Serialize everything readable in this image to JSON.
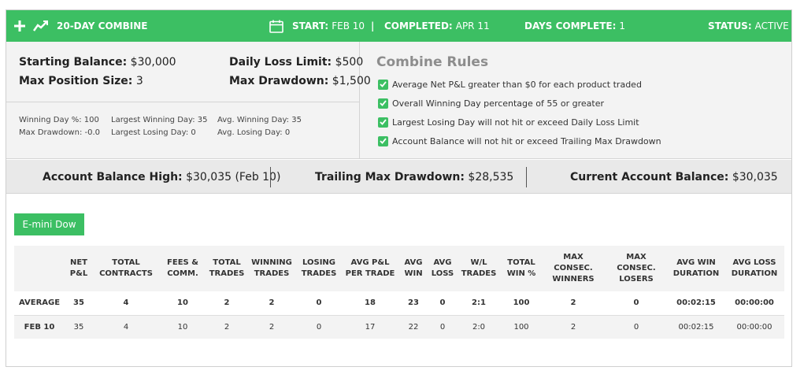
{
  "header": {
    "title": "20-DAY COMBINE",
    "start_label": "START:",
    "start_value": "FEB 10",
    "separator": "|",
    "completed_label": "COMPLETED:",
    "completed_value": "APR 11",
    "days_label": "DAYS COMPLETE:",
    "days_value": "1",
    "status_label": "STATUS:",
    "status_value": "ACTIVE",
    "accent_color": "#3cbf63",
    "icons": [
      "plus-icon",
      "trend-line-icon",
      "calendar-icon"
    ]
  },
  "account": {
    "starting_balance_label": "Starting Balance:",
    "starting_balance": "$30,000",
    "max_position_label": "Max Position Size:",
    "max_position": "3",
    "daily_loss_label": "Daily Loss Limit:",
    "daily_loss": "$500",
    "max_drawdown_label": "Max Drawdown:",
    "max_drawdown": "$1,500"
  },
  "metrics": {
    "winning_day_pct_label": "Winning Day %:",
    "winning_day_pct": "100",
    "max_drawdown_label": "Max Drawdown:",
    "max_drawdown": "-0.0",
    "largest_win_label": "Largest Winning Day:",
    "largest_win": "35",
    "largest_loss_label": "Largest Losing Day:",
    "largest_loss": "0",
    "avg_win_label": "Avg. Winning Day:",
    "avg_win": "35",
    "avg_loss_label": "Avg. Losing Day:",
    "avg_loss": "0"
  },
  "rules": {
    "title": "Combine Rules",
    "items": [
      "Average Net P&L greater than $0 for each product traded",
      "Overall Winning Day percentage of 55 or greater",
      "Largest Losing Day will not hit or exceed Daily Loss Limit",
      "Account Balance will not hit or exceed Trailing Max Drawdown"
    ]
  },
  "balances": {
    "high_label": "Account Balance High:",
    "high_value": "$30,035 (Feb 10)",
    "trailing_label": "Trailing Max Drawdown:",
    "trailing_value": "$28,535",
    "current_label": "Current Account Balance:",
    "current_value": "$30,035"
  },
  "product_tab": "E-mini Dow",
  "table": {
    "headers": [
      "",
      "NET\nP&L",
      "TOTAL\nCONTRACTS",
      "FEES &\nCOMM.",
      "TOTAL\nTRADES",
      "WINNING\nTRADES",
      "LOSING\nTRADES",
      "AVG P&L\nPER TRADE",
      "AVG\nWIN",
      "AVG\nLOSS",
      "W/L\nTRADES",
      "TOTAL\nWIN %",
      "MAX\nCONSEC.\nWINNERS",
      "MAX\nCONSEC.\nLOSERS",
      "AVG WIN\nDURATION",
      "AVG LOSS\nDURATION"
    ],
    "rows": [
      [
        "AVERAGE",
        "35",
        "4",
        "10",
        "2",
        "2",
        "0",
        "18",
        "23",
        "0",
        "2:1",
        "100",
        "2",
        "0",
        "00:02:15",
        "00:00:00"
      ],
      [
        "FEB 10",
        "35",
        "4",
        "10",
        "2",
        "2",
        "0",
        "17",
        "22",
        "0",
        "2:0",
        "100",
        "2",
        "0",
        "00:02:15",
        "00:00:00"
      ]
    ]
  }
}
